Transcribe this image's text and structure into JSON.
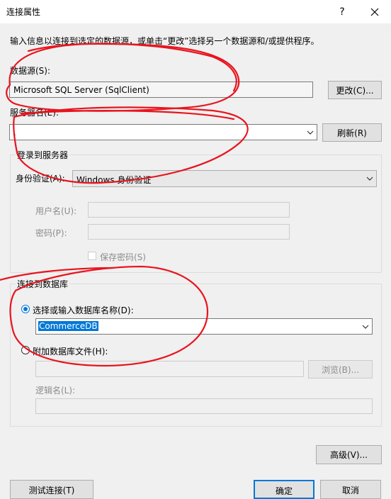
{
  "window": {
    "title": "连接属性",
    "help_btn": "?",
    "close_btn": "✕"
  },
  "intro_text": "输入信息以连接到选定的数据源，或单击“更改”选择另一个数据源和/或提供程序。",
  "datasource": {
    "label": "数据源(S):",
    "value": "Microsoft SQL Server (SqlClient)",
    "change_btn": "更改(C)..."
  },
  "server": {
    "label": "服务器名(E):",
    "value": ".",
    "refresh_btn": "刷新(R)"
  },
  "login_group": {
    "title": "登录到服务器",
    "auth_label": "身份验证(A):",
    "auth_value": "Windows 身份验证",
    "username_label": "用户名(U):",
    "password_label": "密码(P):",
    "save_password_label": "保存密码(S)"
  },
  "db_group": {
    "title": "连接到数据库",
    "select_db_label": "选择或输入数据库名称(D):",
    "db_value": "CommerceDB",
    "attach_label": "附加数据库文件(H):",
    "browse_btn": "浏览(B)...",
    "logical_name_label": "逻辑名(L):"
  },
  "advanced_btn": "高级(V)...",
  "footer": {
    "test_btn": "测试连接(T)",
    "ok_btn": "确定",
    "cancel_btn": "取消"
  },
  "colors": {
    "accent": "#0078d7",
    "annotation": "#e8141e"
  }
}
